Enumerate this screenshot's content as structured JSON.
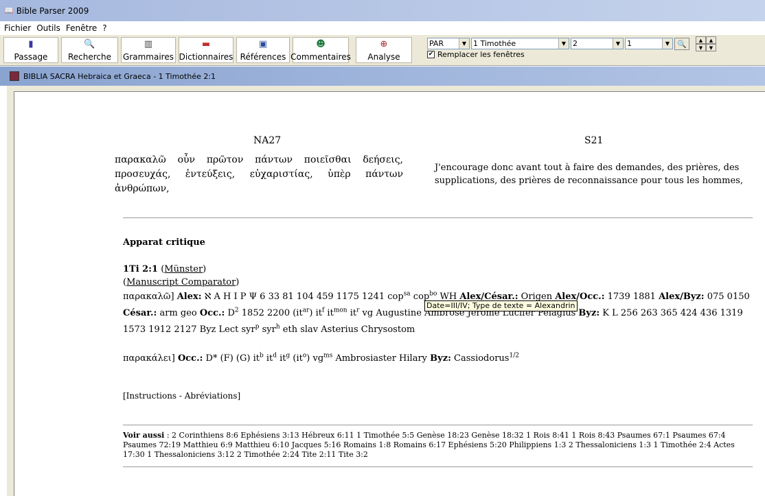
{
  "app": {
    "title": "Bible Parser 2009"
  },
  "menu": {
    "items": [
      "Fichier",
      "Outils",
      "Fenêtre",
      "?"
    ]
  },
  "toolbar": {
    "buttons": [
      {
        "label": "Passage",
        "icon": "book-icon"
      },
      {
        "label": "Recherche",
        "icon": "magnifier-icon"
      },
      {
        "label": "Grammaires",
        "icon": "books-icon"
      },
      {
        "label": "Dictionnaires",
        "icon": "dictionary-icon"
      },
      {
        "label": "Références",
        "icon": "reference-icon"
      },
      {
        "label": "Commentaires",
        "icon": "comment-icon"
      },
      {
        "label": "Analyse",
        "icon": "analysis-icon"
      }
    ],
    "version_select": "PAR",
    "book_select": "1 Timothée",
    "chapter_select": "2",
    "verse_select": "1",
    "replace_windows_label": "Remplacer les fenêtres",
    "replace_windows_checked": true
  },
  "window": {
    "title": "BIBLIA SACRA Hebraica et Graeca - 1 Timothée 2:1"
  },
  "content": {
    "left_header": "NA27",
    "right_header": "S21",
    "greek_text": "παρακαλῶ οὖν πρῶτον πάντων ποιεῖσθαι δεήσεις, προσευχάς, ἐντεύξεις, εὐχαριστίας, ὑπὲρ πάντων ἀνθρώπων,",
    "french_text": "J'encourage donc avant tout à faire des demandes, des prières, des supplications, des prières de reconnaissance pour tous les hommes,",
    "apparatus_title": "Apparat critique",
    "ref_label": "1Ti 2:1",
    "link_munster": "Münster",
    "link_comparator": "Manuscript Comparator",
    "instructions": "[Instructions - Abréviations]",
    "tooltip": "Date=III/IV; Type de texte = Alexandrin",
    "voir_label": "Voir aussi",
    "voir_text": " : 2 Corinthiens 8:6 Ephésiens 3:13 Hébreux 6:11 1 Timothée 5:5 Genèse 18:23 Genèse 18:32 1 Rois 8:41 1 Rois 8:43 Psaumes 67:1 Psaumes 67:4 Psaumes 72:19 Matthieu 6:9 Matthieu 6:10 Jacques 5:16 Romains 1:8 Romains 6:17 Ephésiens 5:20 Philippiens 1:3 2 Thessaloniciens 1:3 1 Timothée 2:4 Actes 17:30 1 Thessaloniciens 3:12 2 Timothée 2:24 Tite 2:11 Tite 3:2"
  }
}
